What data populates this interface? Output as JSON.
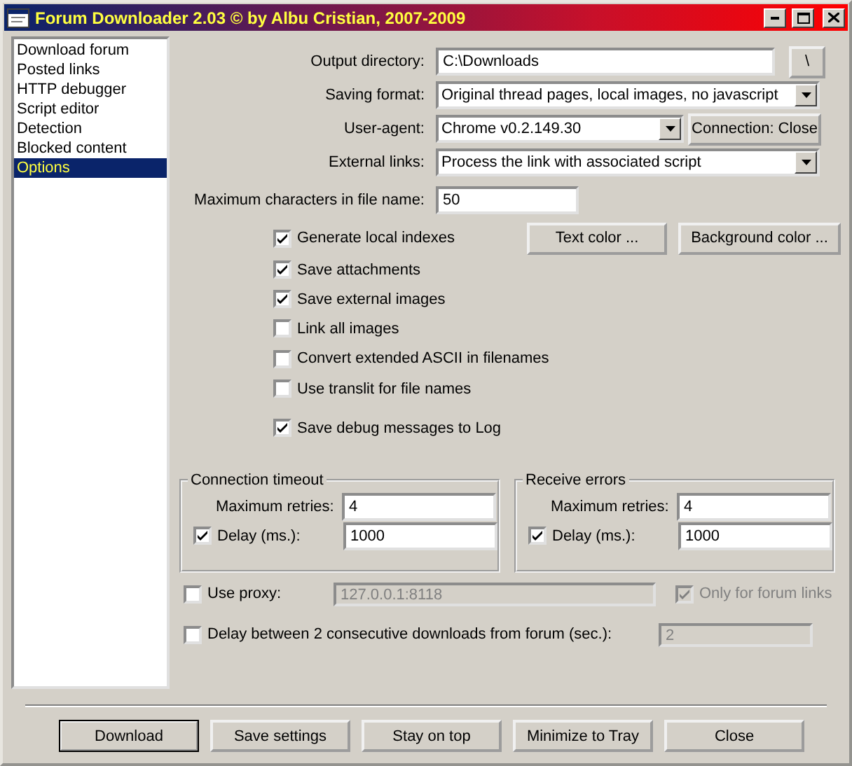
{
  "window": {
    "title": "Forum Downloader 2.03 © by Albu Cristian, 2007-2009"
  },
  "sidebar": {
    "items": [
      {
        "label": "Download forum",
        "selected": false
      },
      {
        "label": "Posted links",
        "selected": false
      },
      {
        "label": "HTTP debugger",
        "selected": false
      },
      {
        "label": "Script editor",
        "selected": false
      },
      {
        "label": "Detection",
        "selected": false
      },
      {
        "label": "Blocked content",
        "selected": false
      },
      {
        "label": "Options",
        "selected": true
      }
    ]
  },
  "output_directory": {
    "label": "Output directory:",
    "value": "C:\\Downloads",
    "button": "\\"
  },
  "saving_format": {
    "label": "Saving format:",
    "value": "Original thread pages, local images, no javascript"
  },
  "user_agent": {
    "label": "User-agent:",
    "value": "Chrome v0.2.149.30",
    "button": "Connection: Close"
  },
  "external_links": {
    "label": "External links:",
    "value": "Process the link with associated script"
  },
  "max_chars": {
    "label": "Maximum characters in file name:",
    "value": "50"
  },
  "color_buttons": [
    "Text color ...",
    "Background color ..."
  ],
  "options": [
    {
      "label": "Generate local indexes",
      "checked": true
    },
    {
      "label": "Save attachments",
      "checked": true
    },
    {
      "label": "Save external images",
      "checked": true
    },
    {
      "label": "Link all images",
      "checked": false
    },
    {
      "label": "Convert extended ASCII in filenames",
      "checked": false
    },
    {
      "label": "Use translit for file names",
      "checked": false
    },
    {
      "label": "Save debug messages to Log",
      "checked": true
    }
  ],
  "groups": [
    {
      "title": "Connection timeout",
      "retries_label": "Maximum retries:",
      "retries": "4",
      "delay_label": "Delay (ms.):",
      "delay_checked": true,
      "delay": "1000"
    },
    {
      "title": "Receive errors",
      "retries_label": "Maximum retries:",
      "retries": "4",
      "delay_label": "Delay (ms.):",
      "delay_checked": true,
      "delay": "1000"
    }
  ],
  "proxy": {
    "label": "Use proxy:",
    "checked": false,
    "value": "127.0.0.1:8118",
    "disabled": true,
    "forum_only": {
      "label": "Only for forum links",
      "checked": true,
      "disabled": true
    }
  },
  "forum_delay": {
    "label": "Delay between 2 consecutive downloads from forum (sec.):",
    "checked": false,
    "value": "2",
    "disabled": true
  },
  "buttons": [
    {
      "label": "Download",
      "default": true
    },
    {
      "label": "Save settings",
      "default": false
    },
    {
      "label": "Stay on top",
      "default": false
    },
    {
      "label": "Minimize to Tray",
      "default": false
    },
    {
      "label": "Close",
      "default": false
    }
  ]
}
